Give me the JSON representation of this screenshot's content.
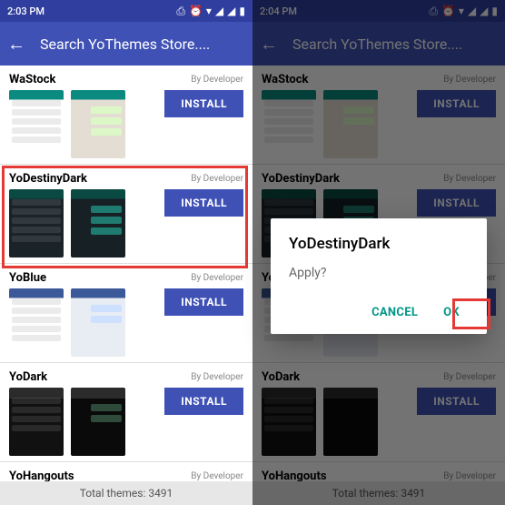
{
  "left": {
    "status": {
      "time": "2:03 PM"
    },
    "appBar": {
      "title": "Search YoThemes Store...."
    },
    "footer": "Total themes: 3491",
    "install": "INSTALL",
    "themes": [
      {
        "name": "WaStock",
        "dev": "By Developer"
      },
      {
        "name": "YoDestinyDark",
        "dev": "By Developer"
      },
      {
        "name": "YoBlue",
        "dev": "By Developer"
      },
      {
        "name": "YoDark",
        "dev": "By Developer"
      },
      {
        "name": "YoHangouts",
        "dev": "By Developer"
      }
    ]
  },
  "right": {
    "status": {
      "time": "2:04 PM"
    },
    "appBar": {
      "title": "Search YoThemes Store...."
    },
    "footer": "Total themes: 3491",
    "install": "INSTALL",
    "themes": [
      {
        "name": "WaStock",
        "dev": "By Developer"
      },
      {
        "name": "YoDestinyDark",
        "dev": "By Developer"
      },
      {
        "name": "YoBlue",
        "dev": "By Developer"
      },
      {
        "name": "YoDark",
        "dev": "By Developer"
      },
      {
        "name": "YoHangouts",
        "dev": "By Developer"
      }
    ],
    "dialog": {
      "title": "YoDestinyDark",
      "message": "Apply?",
      "cancel": "CANCEL",
      "ok": "OK"
    }
  }
}
